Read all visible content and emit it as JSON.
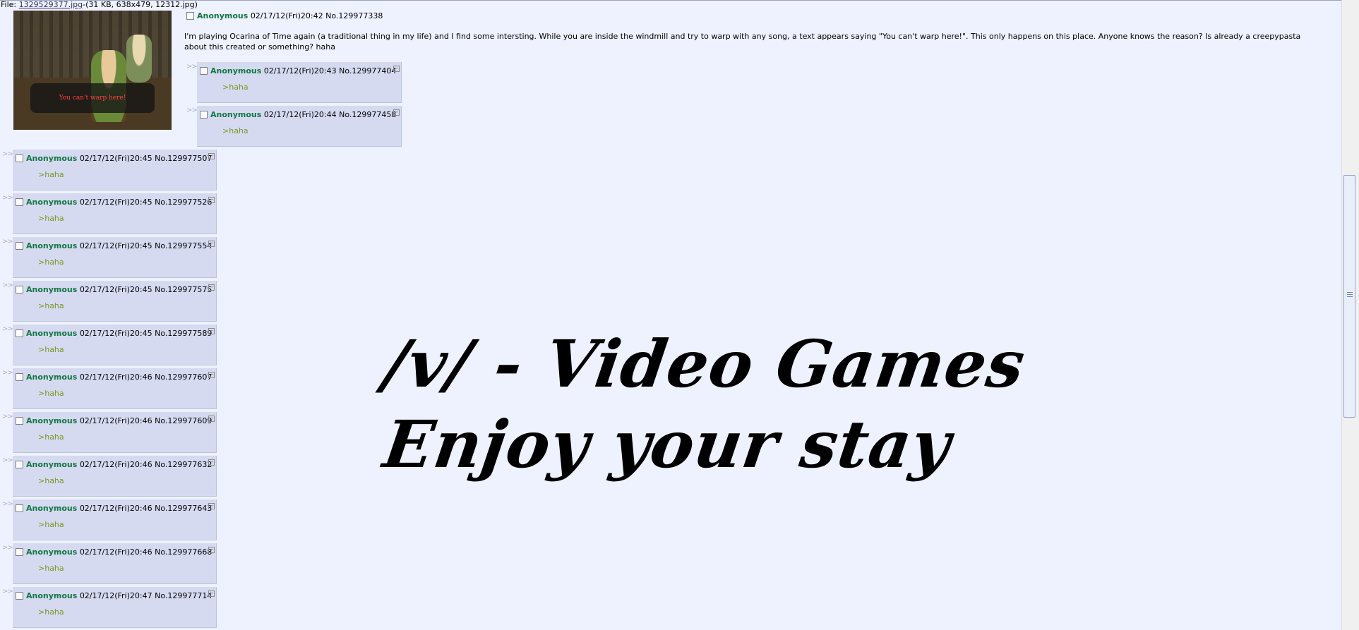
{
  "file": {
    "prefix": "File: ",
    "filename": "1329529377.jpg",
    "details": "-(31 KB, 638x479, 12312.jpg)"
  },
  "thumbnail": {
    "caption": "You can't warp here!"
  },
  "op": {
    "name": "Anonymous",
    "datetime": "02/17/12(Fri)20:42",
    "number": "No.129977338",
    "body": "I'm playing Ocarina of Time again (a traditional thing in my life) and I find some intersting. While you are inside the windmill and try to warp with any song, a text appears saying \"You can't warp here!\". This only happens on this place. Anyone knows the reason? Is already a creepypasta about this created or something? haha"
  },
  "arrow_glyph": ">>",
  "minus_glyph": "−",
  "replies": [
    {
      "name": "Anonymous",
      "datetime": "02/17/12(Fri)20:43",
      "number": "No.129977404",
      "quote": ">haha"
    },
    {
      "name": "Anonymous",
      "datetime": "02/17/12(Fri)20:44",
      "number": "No.129977458",
      "quote": ">haha"
    },
    {
      "name": "Anonymous",
      "datetime": "02/17/12(Fri)20:45",
      "number": "No.129977507",
      "quote": ">haha"
    },
    {
      "name": "Anonymous",
      "datetime": "02/17/12(Fri)20:45",
      "number": "No.129977526",
      "quote": ">haha"
    },
    {
      "name": "Anonymous",
      "datetime": "02/17/12(Fri)20:45",
      "number": "No.129977554",
      "quote": ">haha"
    },
    {
      "name": "Anonymous",
      "datetime": "02/17/12(Fri)20:45",
      "number": "No.129977575",
      "quote": ">haha"
    },
    {
      "name": "Anonymous",
      "datetime": "02/17/12(Fri)20:45",
      "number": "No.129977589",
      "quote": ">haha"
    },
    {
      "name": "Anonymous",
      "datetime": "02/17/12(Fri)20:46",
      "number": "No.129977607",
      "quote": ">haha"
    },
    {
      "name": "Anonymous",
      "datetime": "02/17/12(Fri)20:46",
      "number": "No.129977609",
      "quote": ">haha"
    },
    {
      "name": "Anonymous",
      "datetime": "02/17/12(Fri)20:46",
      "number": "No.129977632",
      "quote": ">haha"
    },
    {
      "name": "Anonymous",
      "datetime": "02/17/12(Fri)20:46",
      "number": "No.129977643",
      "quote": ">haha"
    },
    {
      "name": "Anonymous",
      "datetime": "02/17/12(Fri)20:46",
      "number": "No.129977668",
      "quote": ">haha"
    },
    {
      "name": "Anonymous",
      "datetime": "02/17/12(Fri)20:47",
      "number": "No.129977714",
      "quote": ">haha"
    }
  ],
  "banner": {
    "line1": "/v/ - Video Games",
    "line2": "Enjoy your stay"
  },
  "colors": {
    "background": "#eef2ff",
    "reply_background": "#d6daf0",
    "name": "#117743",
    "quote": "#789922"
  }
}
